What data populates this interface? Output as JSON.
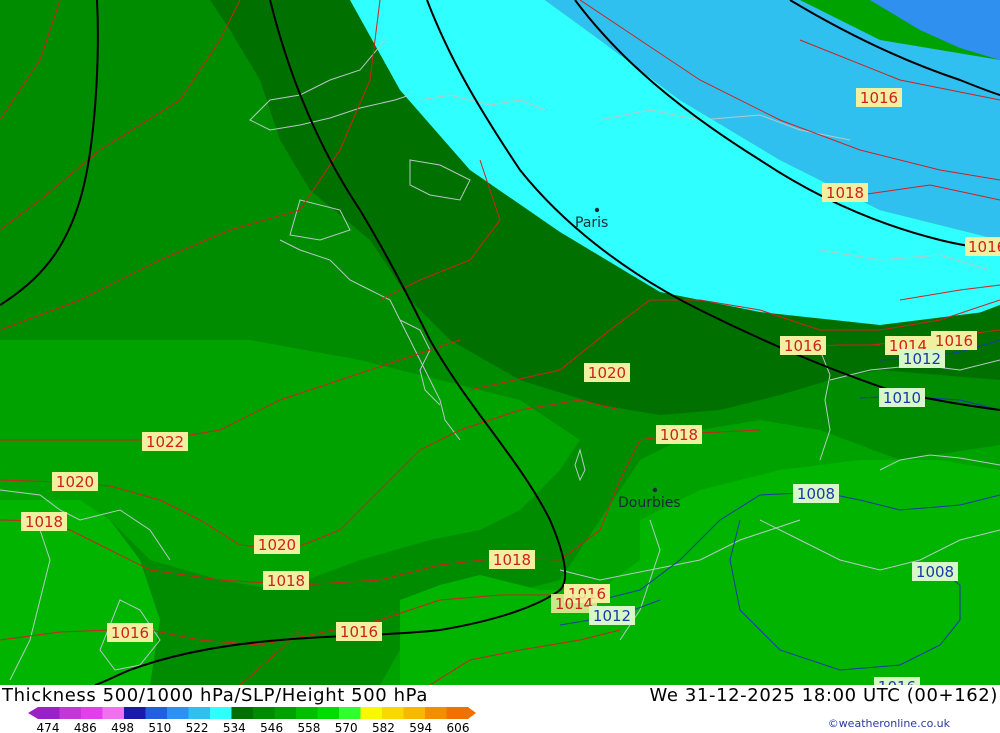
{
  "title": "Thickness 500/1000 hPa/SLP/Height 500 hPa",
  "datetime": "We 31-12-2025 18:00 UTC (00+162)",
  "credit": "©weatheronline.co.uk",
  "cities": [
    {
      "name": "Paris"
    },
    {
      "name": "Dourbies"
    }
  ],
  "slp_labels_red": [
    "1016",
    "1018",
    "1018",
    "1020",
    "1018",
    "1022",
    "1020",
    "1018",
    "1020",
    "1018",
    "1018",
    "1016",
    "1016",
    "1016",
    "1014",
    "1016",
    "1014",
    "1016",
    "1016"
  ],
  "slp_labels_blue": [
    "1012",
    "1010",
    "1008",
    "1008",
    "1012"
  ],
  "slp_label_partial": "1016",
  "colorbar": {
    "ticks": [
      "474",
      "486",
      "498",
      "510",
      "522",
      "534",
      "546",
      "558",
      "570",
      "582",
      "594",
      "606"
    ],
    "colors": [
      "#9b21c4",
      "#c238d4",
      "#e040e8",
      "#f070f0",
      "#1a1aa8",
      "#2060e0",
      "#3090f0",
      "#30c0f0",
      "#30ffff",
      "#007000",
      "#008a00",
      "#00a000",
      "#00be00",
      "#00dc00",
      "#30ff30",
      "#f8f800",
      "#f8d800",
      "#f8b800",
      "#f09000",
      "#f07000"
    ]
  },
  "colors": {
    "thickness_534": "#007000",
    "thickness_540": "#008c00",
    "thickness_546": "#00a200",
    "thickness_552": "#00b400",
    "thickness_528": "#30ffff",
    "thickness_522": "#30c0f0",
    "thickness_516": "#3090f0",
    "slp_red": "#d02020",
    "slp_blue": "#1a3aa8",
    "height_500": "#000000",
    "coast": "#b8c8c8"
  }
}
